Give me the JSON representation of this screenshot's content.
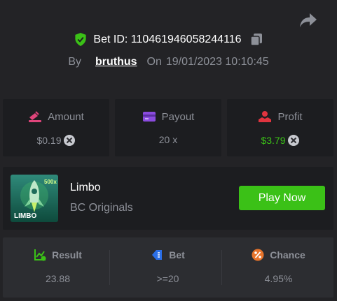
{
  "colors": {
    "background": "#232326",
    "card": "#1c1d20",
    "panel": "#2c2d31",
    "accent_green": "#3bc117",
    "muted_text": "#8d9098"
  },
  "header": {
    "bet_id_label": "Bet ID: 110461946058244116",
    "by_label": "By",
    "username": "bruthus",
    "on_label": "On",
    "datetime": "19/01/2023 10:10:45"
  },
  "stats": {
    "amount": {
      "label": "Amount",
      "value": "$0.19",
      "icon": "amount-icon"
    },
    "payout": {
      "label": "Payout",
      "value": "20 x",
      "icon": "payout-icon"
    },
    "profit": {
      "label": "Profit",
      "value": "$3.79",
      "icon": "profit-icon"
    }
  },
  "game": {
    "thumb_badge": "500x",
    "thumb_text": "LIMBO",
    "name": "Limbo",
    "provider": "BC Originals",
    "play_label": "Play Now"
  },
  "result": {
    "result_label": "Result",
    "result_value": "23.88",
    "bet_label": "Bet",
    "bet_value": ">=20",
    "chance_label": "Chance",
    "chance_value": "4.95%"
  }
}
